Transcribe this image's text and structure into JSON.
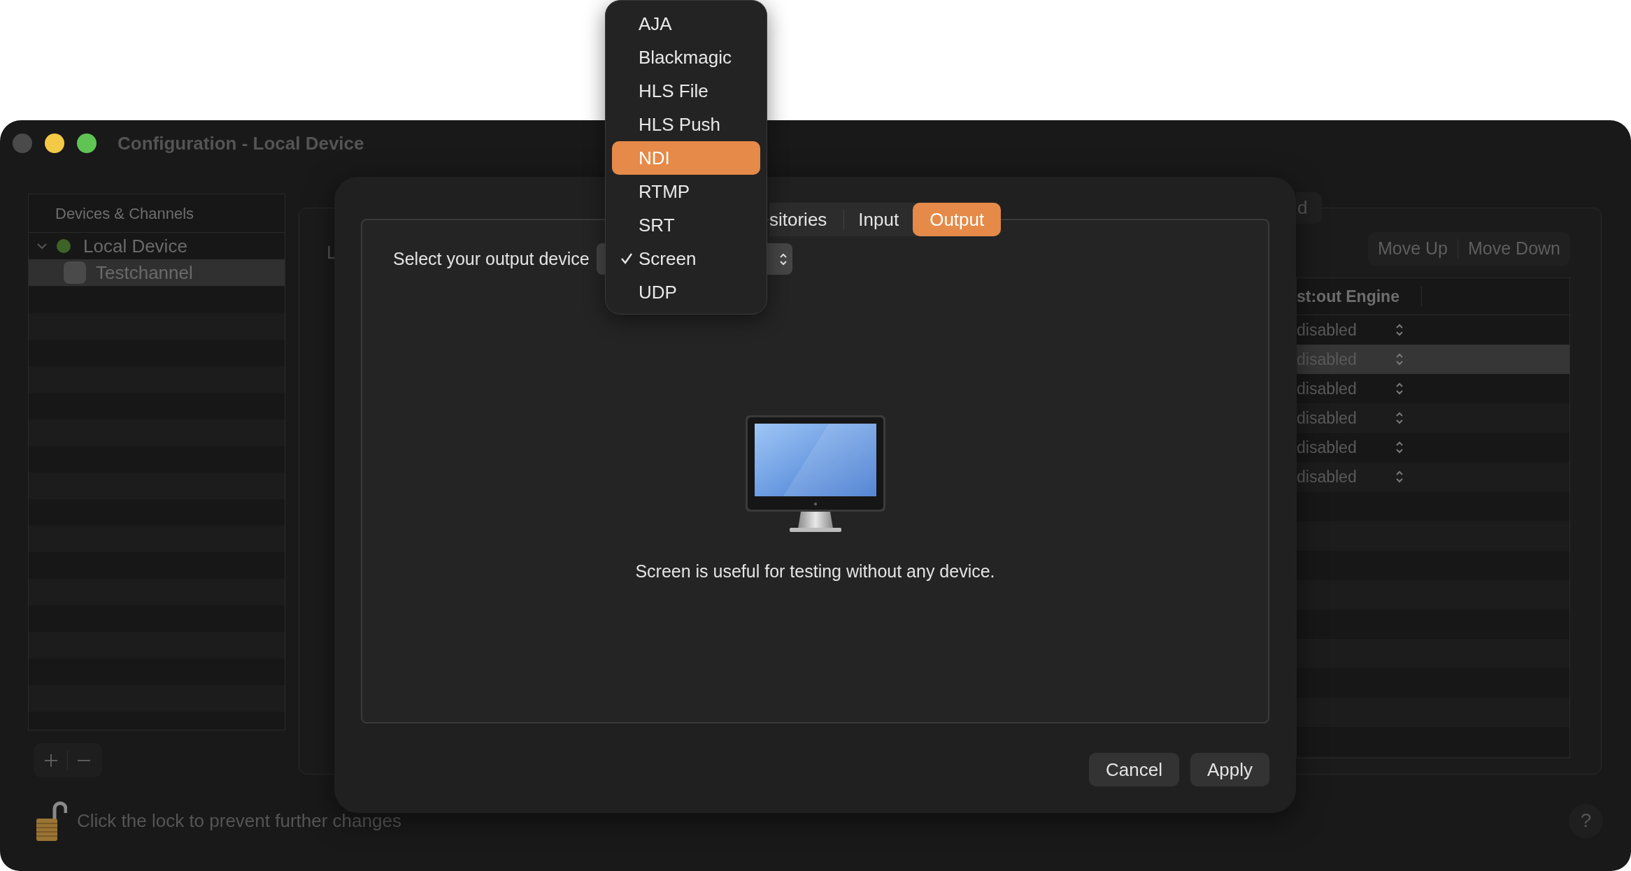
{
  "window": {
    "title": "Configuration - Local Device"
  },
  "sidebar": {
    "header": "Devices & Channels",
    "items": [
      {
        "label": "Local Device",
        "expanded": true,
        "selected": false,
        "color": "#3e6326",
        "children": [
          {
            "label": "Testchannel",
            "selected": true
          }
        ]
      }
    ]
  },
  "main": {
    "label_fragment": "L",
    "tab_fragment": "d",
    "move_buttons": [
      "Move Up",
      "Move Down"
    ],
    "table": {
      "column": "st:out Engine",
      "rows": [
        {
          "value": "disabled",
          "selected": false
        },
        {
          "value": "disabled",
          "selected": true
        },
        {
          "value": "disabled",
          "selected": false
        },
        {
          "value": "disabled",
          "selected": false
        },
        {
          "value": "disabled",
          "selected": false
        },
        {
          "value": "disabled",
          "selected": false
        }
      ]
    }
  },
  "footer": {
    "locked": false,
    "text": "Click the lock to prevent further changes",
    "help": "?"
  },
  "sheet": {
    "tabs": [
      {
        "label": "sitories",
        "selected": false
      },
      {
        "label": "Input",
        "selected": false
      },
      {
        "label": "Output",
        "selected": true
      }
    ],
    "prompt": "Select your output device",
    "caption": "Screen is useful for testing without any device.",
    "buttons": [
      "Cancel",
      "Apply"
    ]
  },
  "menu": {
    "items": [
      {
        "label": "AJA",
        "highlighted": false,
        "checked": false
      },
      {
        "label": "Blackmagic",
        "highlighted": false,
        "checked": false
      },
      {
        "label": "HLS File",
        "highlighted": false,
        "checked": false
      },
      {
        "label": "HLS Push",
        "highlighted": false,
        "checked": false
      },
      {
        "label": "NDI",
        "highlighted": true,
        "checked": false
      },
      {
        "label": "RTMP",
        "highlighted": false,
        "checked": false
      },
      {
        "label": "SRT",
        "highlighted": false,
        "checked": false
      },
      {
        "label": "Screen",
        "highlighted": false,
        "checked": true
      },
      {
        "label": "UDP",
        "highlighted": false,
        "checked": false
      }
    ]
  }
}
